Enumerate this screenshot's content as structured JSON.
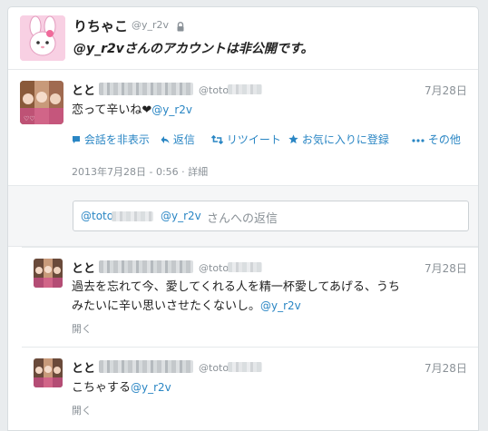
{
  "profile": {
    "name": "りちゃこ",
    "handle": "@y_r2v",
    "notice": "@y_r2vさんのアカウントは非公開です。"
  },
  "main_tweet": {
    "user_name": "とと",
    "handle": "@toto",
    "date": "7月28日",
    "text": "恋って辛いね❤",
    "mention": "@y_r2v",
    "actions": {
      "hide_conversation": "会話を非表示",
      "reply": "返信",
      "retweet": "リツイート",
      "favorite": "お気に入りに登録",
      "more": "その他"
    },
    "timestamp": "2013年7月28日 - 0:56",
    "details": "詳細"
  },
  "reply_box": {
    "mention_prefix": "@toto",
    "mention_target": "@y_r2v",
    "suffix": "さんへの返信"
  },
  "replies": [
    {
      "user_name": "とと",
      "handle": "@toto",
      "date": "7月28日",
      "text_line1": "過去を忘れて今、愛してくれる人を精一杯愛してあげる、うち",
      "text_line2": "みたいに辛い思いさせたくないし。",
      "mention": "@y_r2v",
      "open": "開く"
    },
    {
      "user_name": "とと",
      "handle": "@toto",
      "date": "7月28日",
      "text_line1": "こちゃする",
      "mention": "@y_r2v",
      "open": "開く"
    }
  ],
  "colors": {
    "link": "#2a86c4",
    "muted": "#8a9197",
    "text": "#222222"
  }
}
